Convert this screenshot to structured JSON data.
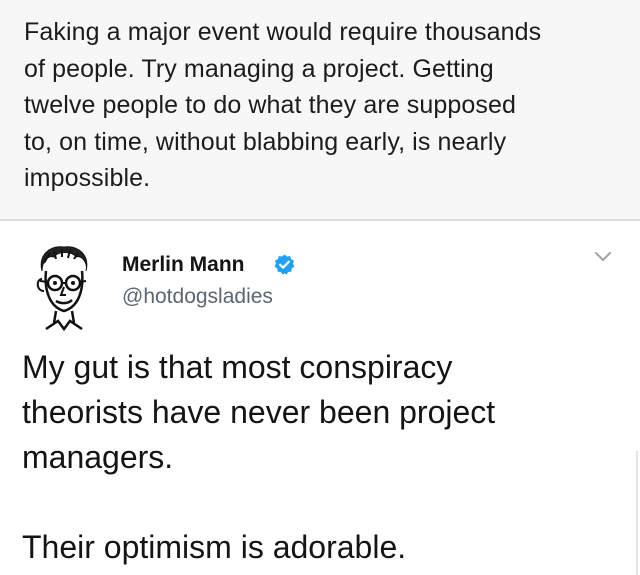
{
  "top_post": {
    "text": "Faking a major event would require thousands\nof people.  Try managing a project.  Getting\ntwelve people to do what they are supposed\nto, on time, without blabbing early, is nearly\nimpossible."
  },
  "tweet": {
    "author_name": "Merlin Mann",
    "handle": "@hotdogsladies",
    "avatar_icon": "cartoon-portrait-avatar",
    "verified_icon": "verified-badge-icon",
    "menu_icon": "chevron-down-icon",
    "verified_color": "#1da1f2",
    "body_paragraph_1": "My gut is that most conspiracy\ntheorists have never been project\nmanagers.",
    "body_paragraph_2": "Their optimism is adorable."
  }
}
